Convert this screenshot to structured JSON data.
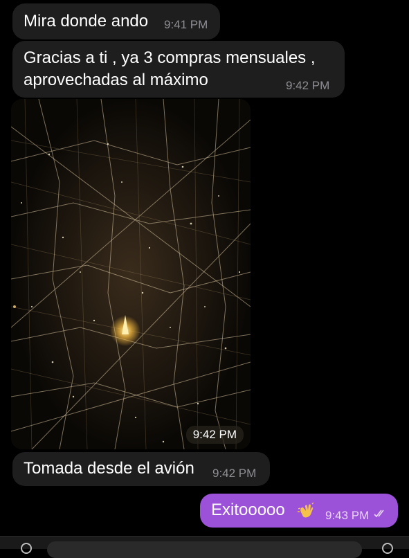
{
  "messages": [
    {
      "direction": "incoming",
      "text": "Mira donde ando",
      "time": "9:41 PM"
    },
    {
      "direction": "incoming",
      "text": "Gracias a ti , ya 3 compras mensuales , aprovechadas al máximo",
      "line1": "Gracias a ti , ya 3 compras mensuales ,",
      "line2": "aprovechadas al máximo",
      "time": "9:42 PM"
    },
    {
      "direction": "incoming",
      "type": "photo",
      "time": "9:42 PM"
    },
    {
      "direction": "incoming",
      "text": "Tomada desde el avión",
      "time": "9:42 PM"
    },
    {
      "direction": "outgoing",
      "text": "Exitooooo",
      "emoji": "waving-hand-emoji",
      "time": "9:43 PM",
      "status": "read"
    }
  ],
  "colors": {
    "background": "#000000",
    "incoming_bubble": "#1e1e1e",
    "outgoing_bubble": "#9b52d8",
    "timestamp": "#8e8e93"
  }
}
